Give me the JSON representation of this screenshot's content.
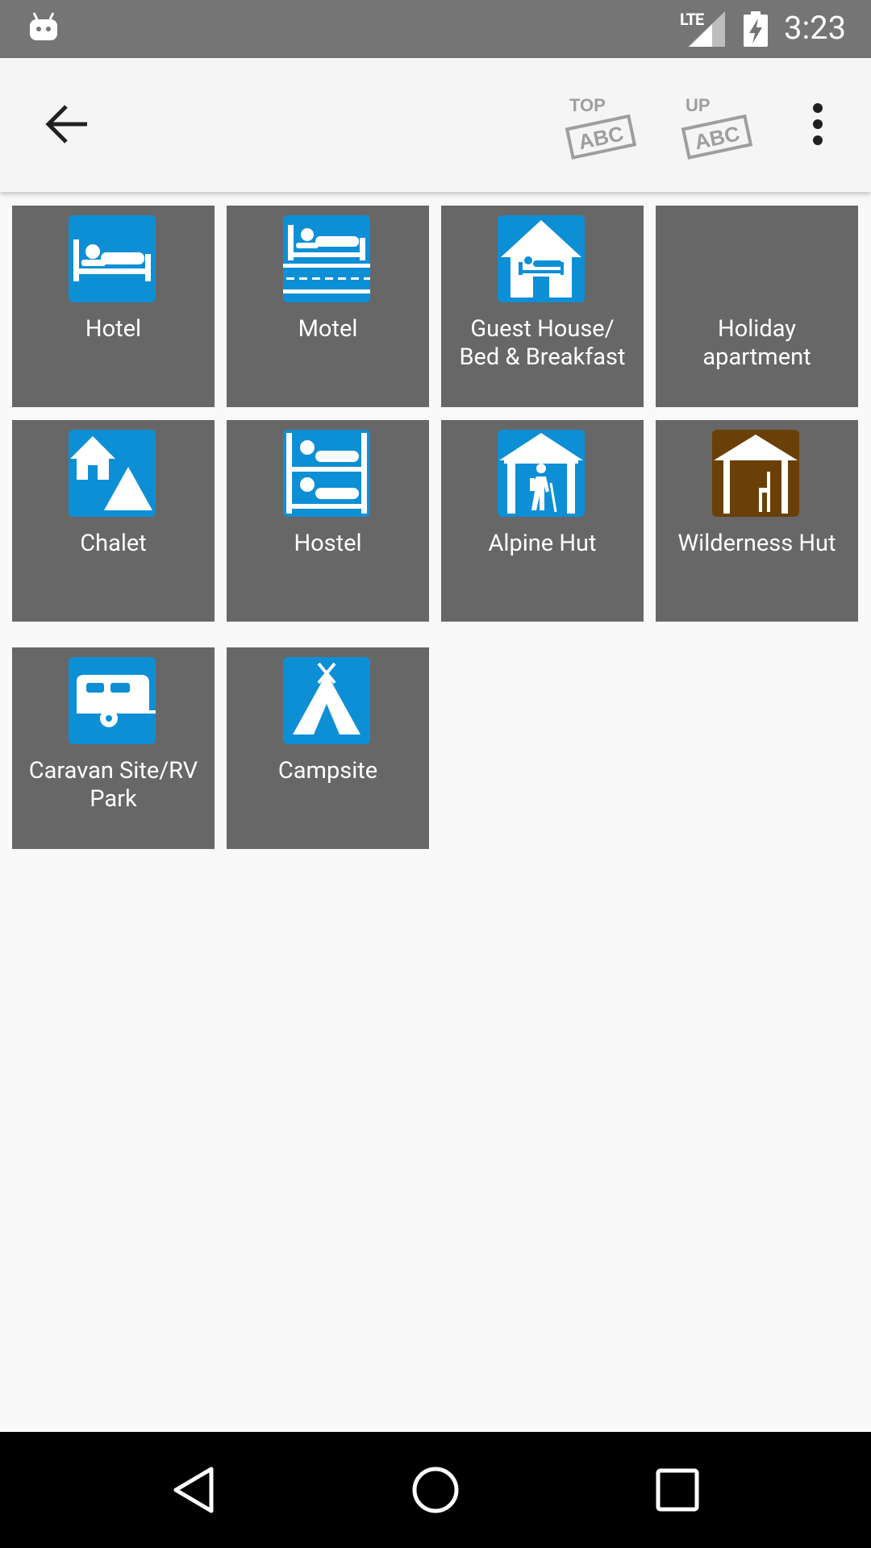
{
  "status_bar": {
    "network": "LTE",
    "time": "3:23"
  },
  "app_bar": {
    "top_abc": {
      "small": "TOP",
      "big": "ABC"
    },
    "up_abc": {
      "small": "UP",
      "big": "ABC"
    }
  },
  "tiles": [
    {
      "label": "Hotel",
      "icon": "hotel-bed-icon",
      "color": "#0d8fd6"
    },
    {
      "label": "Motel",
      "icon": "motel-bed-road-icon",
      "color": "#0d8fd6"
    },
    {
      "label": "Guest House/\nBed & Breakfast",
      "icon": "guest-house-icon",
      "color": "#0d8fd6"
    },
    {
      "label": "Holiday\napartment",
      "icon": null
    },
    {
      "label": "Chalet",
      "icon": "chalet-icon",
      "color": "#0d8fd6"
    },
    {
      "label": "Hostel",
      "icon": "bunk-bed-icon",
      "color": "#0d8fd6"
    },
    {
      "label": "Alpine Hut",
      "icon": "alpine-hut-hiker-icon",
      "color": "#0d8fd6"
    },
    {
      "label": "Wilderness Hut",
      "icon": "wilderness-hut-icon",
      "color": "#6a4008"
    },
    {
      "label": "Caravan Site/RV\nPark",
      "icon": "caravan-icon",
      "color": "#0d8fd6"
    },
    {
      "label": "Campsite",
      "icon": "tent-icon",
      "color": "#0d8fd6"
    }
  ],
  "colors": {
    "status_bar": "#757575",
    "app_bar": "#f5f5f5",
    "tile_background": "#676767",
    "icon_blue": "#0d8fd6",
    "icon_brown": "#6a4008",
    "nav_bar": "#000000"
  }
}
